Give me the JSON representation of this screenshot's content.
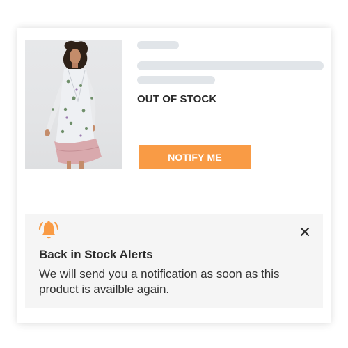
{
  "product": {
    "image_alt": "Woman wearing a floral print wrap dress with ruffled hem",
    "stock_status": "OUT OF STOCK",
    "notify_button_label": "NOTIFY ME"
  },
  "alert": {
    "icon": "bell-icon",
    "close_icon": "close-icon",
    "title": "Back in Stock Alerts",
    "message": "We will send you a notification as soon as this product is availble again."
  },
  "colors": {
    "accent": "#f99b45",
    "skeleton": "#e1e5e9",
    "panel": "#f5f5f5",
    "text": "#2b2b2b"
  }
}
